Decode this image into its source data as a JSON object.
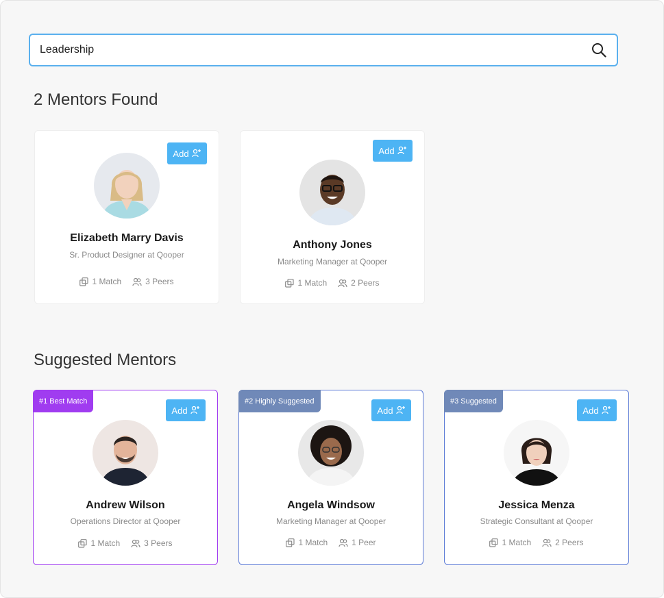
{
  "search": {
    "value": "Leadership",
    "placeholder": "Search mentors"
  },
  "results": {
    "title": "2 Mentors Found",
    "mentors": [
      {
        "name": "Elizabeth Marry Davis",
        "role": "Sr. Product Designer at  Qooper",
        "matches": "1 Match",
        "peers": "3 Peers",
        "add_label": "Add"
      },
      {
        "name": "Anthony Jones",
        "role": "Marketing Manager at Qooper",
        "matches": "1 Match",
        "peers": "2 Peers",
        "add_label": "Add"
      }
    ]
  },
  "suggested": {
    "title": "Suggested Mentors",
    "mentors": [
      {
        "badge": "#1  Best Match",
        "name": "Andrew Wilson",
        "role": "Operations Director at Qooper",
        "matches": "1 Match",
        "peers": "3 Peers",
        "add_label": "Add"
      },
      {
        "badge": "#2  Highly Suggested",
        "name": "Angela Windsow",
        "role": "Marketing Manager at Qooper",
        "matches": "1 Match",
        "peers": "1 Peer",
        "add_label": "Add"
      },
      {
        "badge": "#3  Suggested",
        "name": "Jessica Menza",
        "role": "Strategic Consultant at Qooper",
        "matches": "1 Match",
        "peers": "2 Peers",
        "add_label": "Add"
      }
    ]
  },
  "colors": {
    "accent": "#4db4f4",
    "search_border": "#5ab0ee",
    "best_match": "#a03cf0",
    "suggested": "#7089b8",
    "suggested_border": "#5b7ad6"
  },
  "icons": {
    "search": "search-icon",
    "add": "add-person-icon",
    "match": "match-icon",
    "peers": "peers-icon"
  }
}
